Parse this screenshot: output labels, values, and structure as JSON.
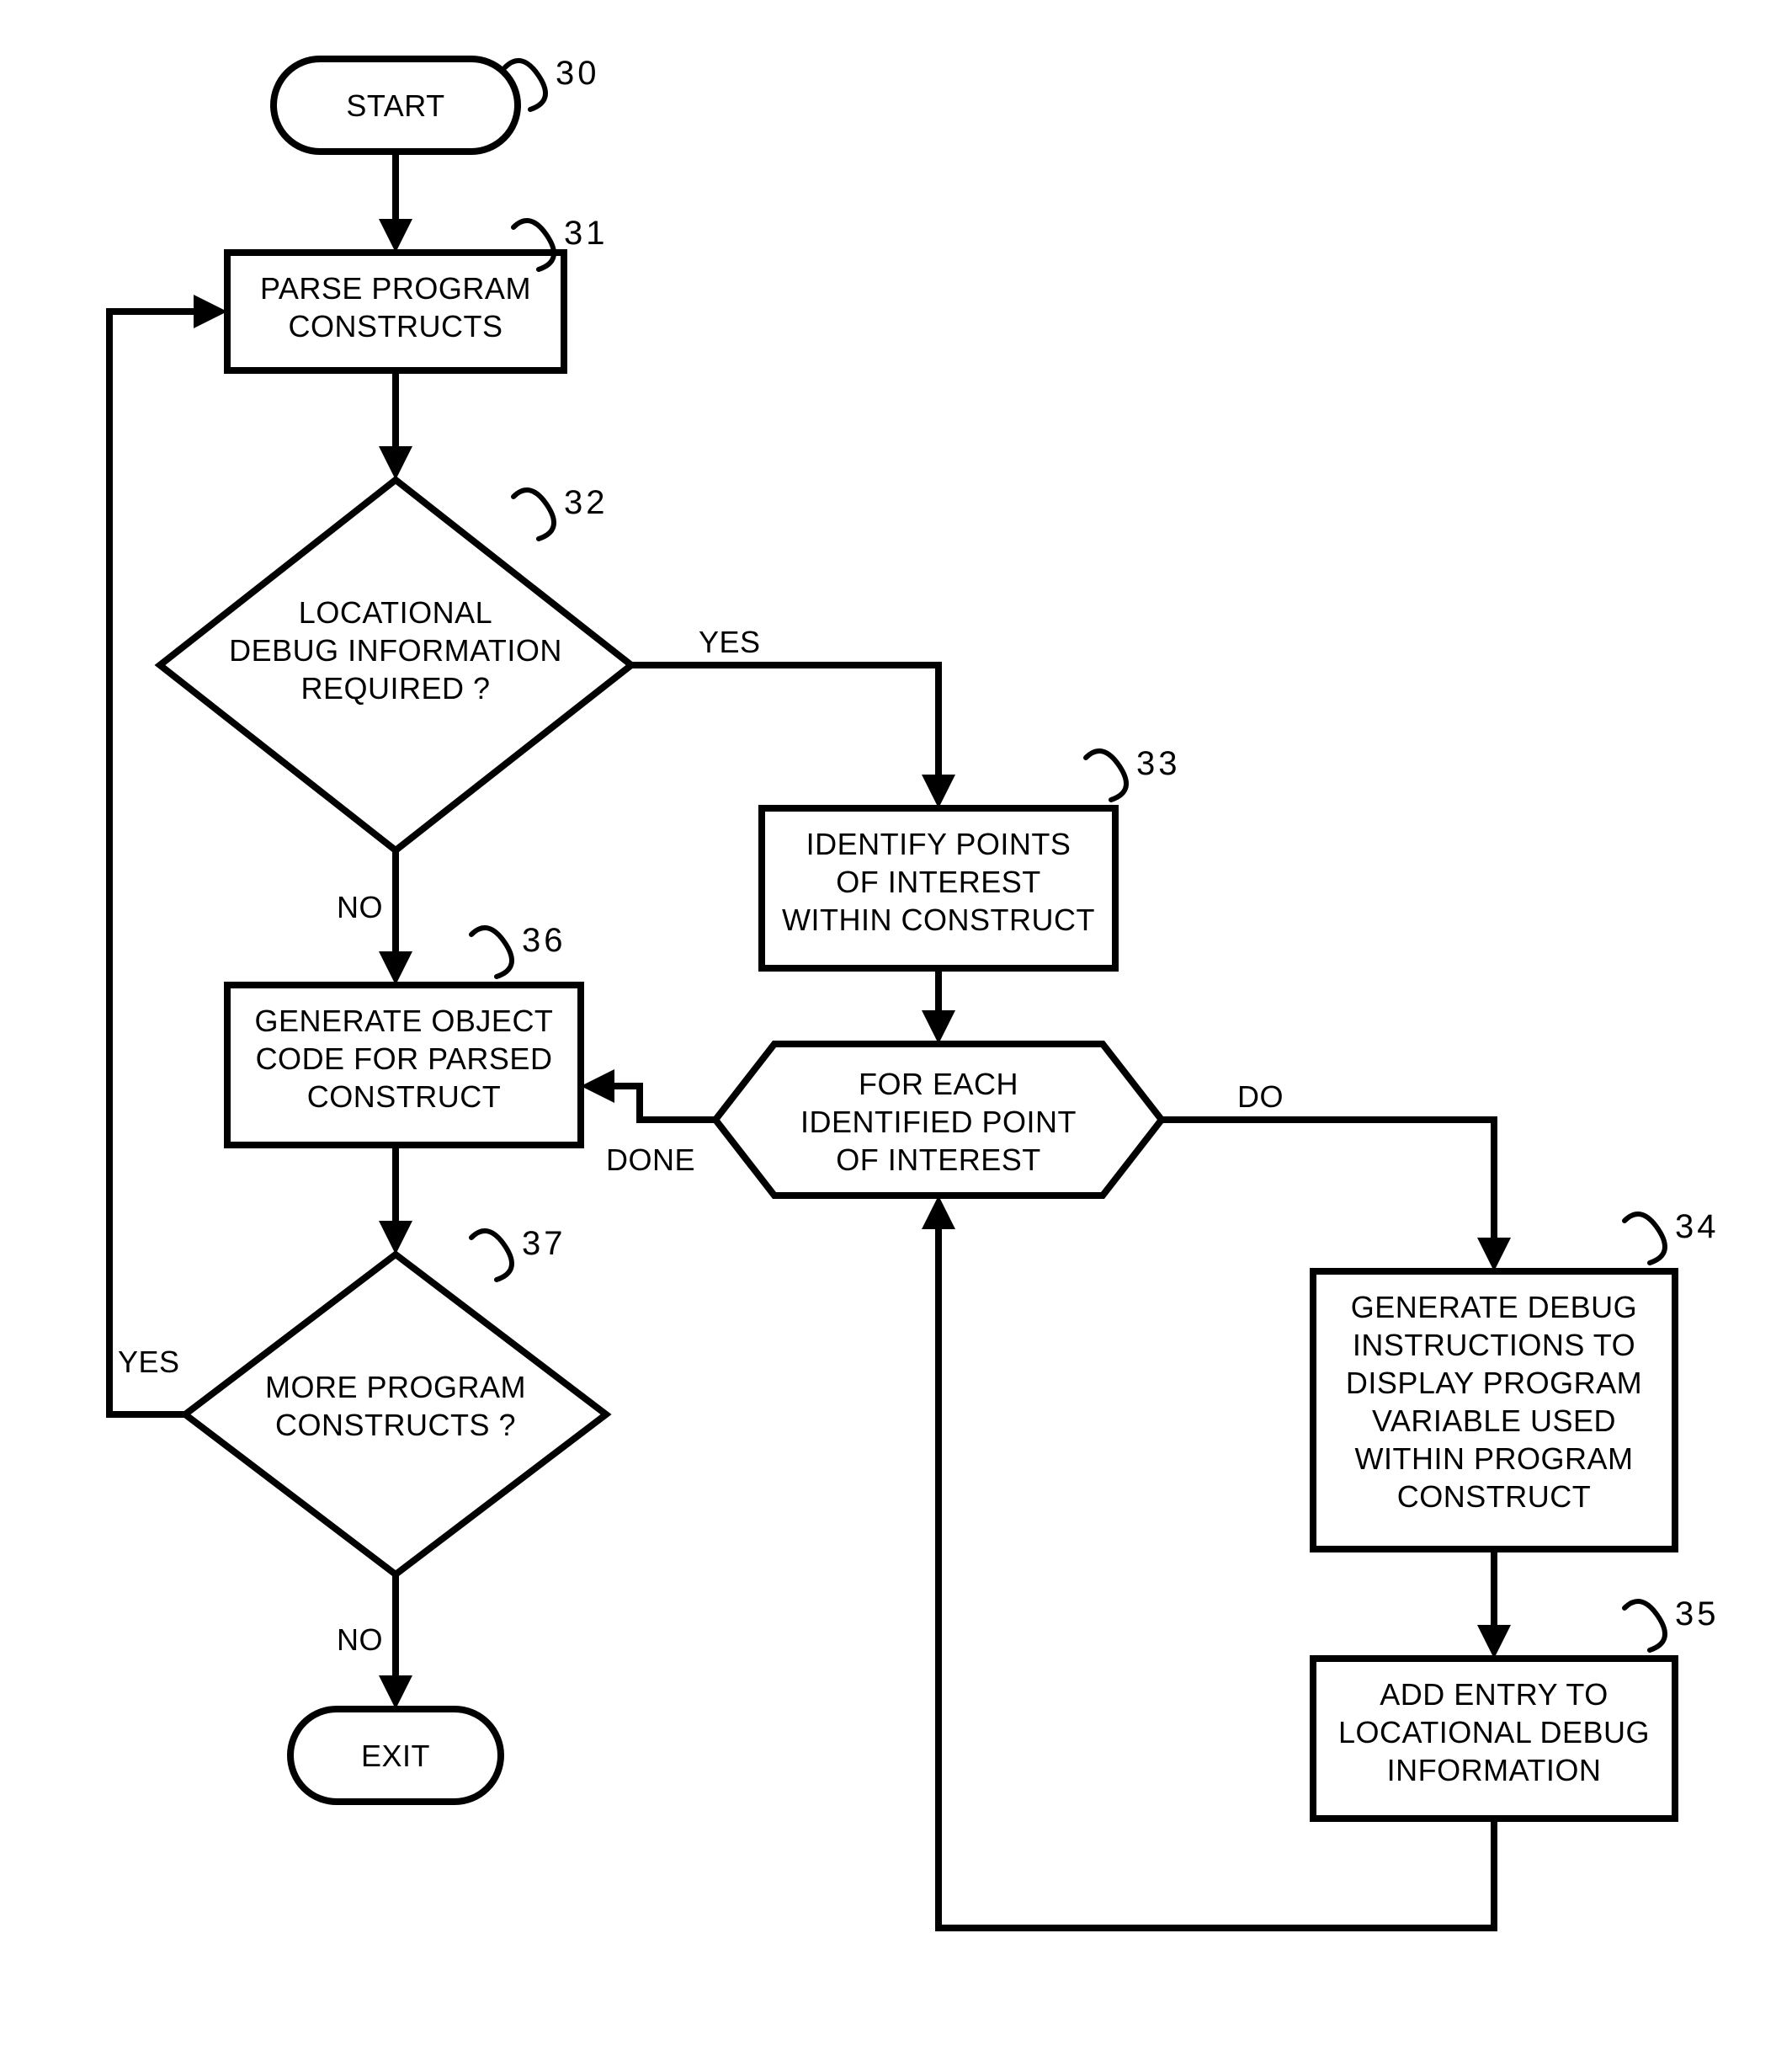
{
  "diagram": {
    "nodes": {
      "start": {
        "ref": "30",
        "lines": [
          "START"
        ]
      },
      "parse": {
        "ref": "31",
        "lines": [
          "PARSE PROGRAM",
          "CONSTRUCTS"
        ]
      },
      "decide_loc": {
        "ref": "32",
        "lines": [
          "LOCATIONAL",
          "DEBUG INFORMATION",
          "REQUIRED ?"
        ]
      },
      "identify": {
        "ref": "33",
        "lines": [
          "IDENTIFY POINTS",
          "OF INTEREST",
          "WITHIN CONSTRUCT"
        ]
      },
      "foreach": {
        "lines": [
          "FOR EACH",
          "IDENTIFIED POINT",
          "OF INTEREST"
        ]
      },
      "gen_debug": {
        "ref": "34",
        "lines": [
          "GENERATE DEBUG",
          "INSTRUCTIONS TO",
          "DISPLAY PROGRAM",
          "VARIABLE USED",
          "WITHIN PROGRAM",
          "CONSTRUCT"
        ]
      },
      "add_entry": {
        "ref": "35",
        "lines": [
          "ADD ENTRY TO",
          "LOCATIONAL DEBUG",
          "INFORMATION"
        ]
      },
      "gen_obj": {
        "ref": "36",
        "lines": [
          "GENERATE OBJECT",
          "CODE FOR PARSED",
          "CONSTRUCT"
        ]
      },
      "decide_more": {
        "ref": "37",
        "lines": [
          "MORE PROGRAM",
          "CONSTRUCTS ?"
        ]
      },
      "exit": {
        "lines": [
          "EXIT"
        ]
      }
    },
    "edge_labels": {
      "yes": "YES",
      "no": "NO",
      "do": "DO",
      "done": "DONE"
    }
  }
}
